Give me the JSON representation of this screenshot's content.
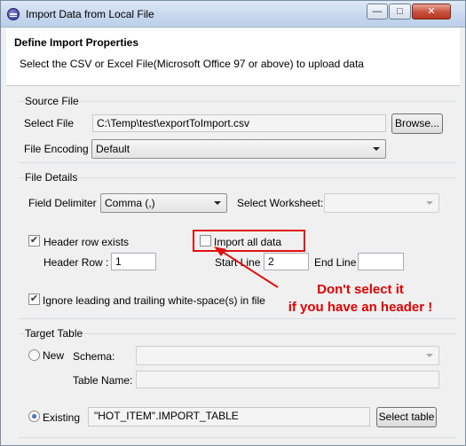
{
  "window": {
    "title": "Import Data from Local File"
  },
  "header": {
    "title": "Define Import Properties",
    "description": "Select the CSV or Excel File(Microsoft Office 97 or above) to upload data"
  },
  "source_file": {
    "legend": "Source File",
    "select_file_label": "Select File",
    "file_path": "C:\\Temp\\test\\exportToImport.csv",
    "browse_label": "Browse...",
    "encoding_label": "File Encoding",
    "encoding_value": "Default"
  },
  "file_details": {
    "legend": "File Details",
    "field_delimiter_label": "Field Delimiter",
    "field_delimiter_value": "Comma (,)",
    "select_worksheet_label": "Select Worksheet:",
    "header_row_exists_label": "Header row exists",
    "header_row_exists_checked": true,
    "import_all_label": "Import all data",
    "import_all_checked": false,
    "header_row_label": "Header Row :",
    "header_row_value": "1",
    "start_line_label": "Start Line",
    "start_line_value": "2",
    "end_line_label": "End Line",
    "end_line_value": "",
    "ignore_ws_label": "Ignore leading and trailing white-space(s) in file",
    "ignore_ws_checked": true
  },
  "annotation": {
    "line1": "Don't select it",
    "line2": "if you have an header !",
    "color": "#e00000"
  },
  "target_table": {
    "legend": "Target Table",
    "new_label": "New",
    "schema_label": "Schema:",
    "table_name_label": "Table Name:",
    "existing_label": "Existing",
    "existing_value": "\"HOT_ITEM\".IMPORT_TABLE",
    "select_table_label": "Select table",
    "selected_option": "Existing"
  }
}
